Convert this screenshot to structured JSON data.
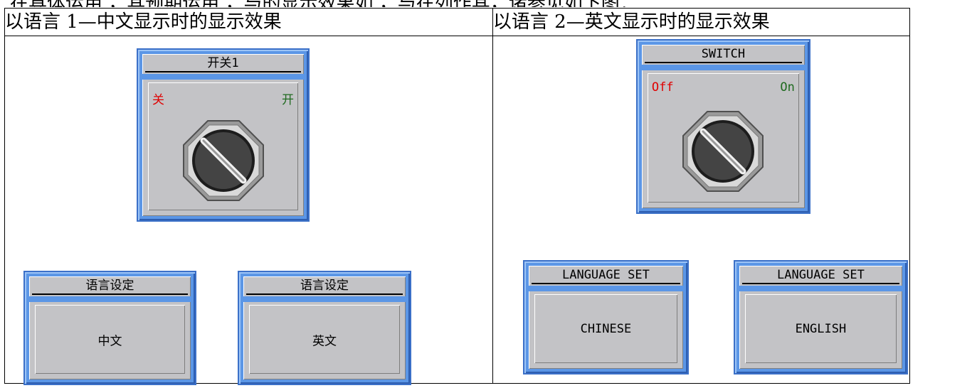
{
  "top_partial_text": "在具体运用 ，其预期运用 ，与的显示效果如 ，与在列作其，诸参见如下图：",
  "table": {
    "headers": [
      "以语言 1—中文显示时的显示效果",
      "以语言 2—英文显示时的显示效果"
    ]
  },
  "chinese": {
    "switch_title": "开关1",
    "switch_off": "关",
    "switch_on": "开",
    "lang_title": "语言设定",
    "btn_chinese": "中文",
    "btn_english": "英文"
  },
  "english": {
    "switch_title": "SWITCH",
    "switch_off": "Off",
    "switch_on": "On",
    "lang_title": "LANGUAGE SET",
    "btn_chinese": "CHINESE",
    "btn_english": "ENGLISH"
  },
  "colors": {
    "frame_blue": "#5b96e6",
    "panel_gray": "#c3c3c6",
    "off_red": "#e00000",
    "on_green": "#1f6a1f"
  }
}
